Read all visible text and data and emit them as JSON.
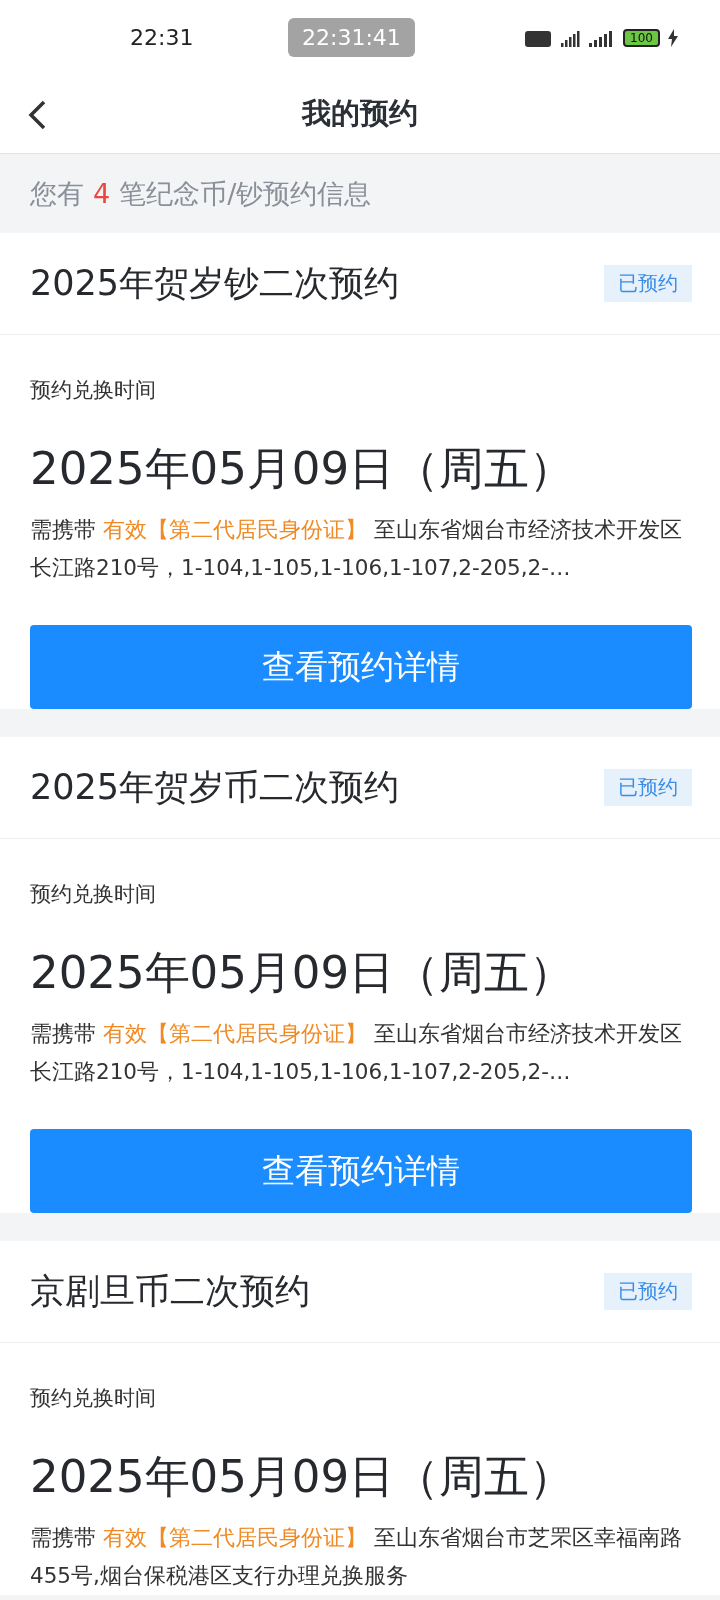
{
  "status_bar": {
    "time": "22:31",
    "clock_overlay": "22:31:41",
    "battery": "100"
  },
  "nav": {
    "title": "我的预约"
  },
  "notice": {
    "prefix": "您有",
    "count": "4",
    "suffix": "笔纪念币/钞预约信息"
  },
  "cards": [
    {
      "title": "2025年贺岁钞二次预约",
      "status": "已预约",
      "time_label": "预约兑换时间",
      "date": "2025年05月09日（周五）",
      "desc_prefix": "需携带",
      "desc_highlight": "有效【第二代居民身份证】",
      "desc_rest": "至山东省烟台市经济技术开发区长江路210号，1-104,1-105,1-106,1-107,2-205,2-…",
      "button": "查看预约详情"
    },
    {
      "title": "2025年贺岁币二次预约",
      "status": "已预约",
      "time_label": "预约兑换时间",
      "date": "2025年05月09日（周五）",
      "desc_prefix": "需携带",
      "desc_highlight": "有效【第二代居民身份证】",
      "desc_rest": "至山东省烟台市经济技术开发区长江路210号，1-104,1-105,1-106,1-107,2-205,2-…",
      "button": "查看预约详情"
    },
    {
      "title": "京剧旦币二次预约",
      "status": "已预约",
      "time_label": "预约兑换时间",
      "date": "2025年05月09日（周五）",
      "desc_prefix": "需携带",
      "desc_highlight": "有效【第二代居民身份证】",
      "desc_rest": "至山东省烟台市芝罘区幸福南路455号,烟台保税港区支行办理兑换服务"
    }
  ]
}
